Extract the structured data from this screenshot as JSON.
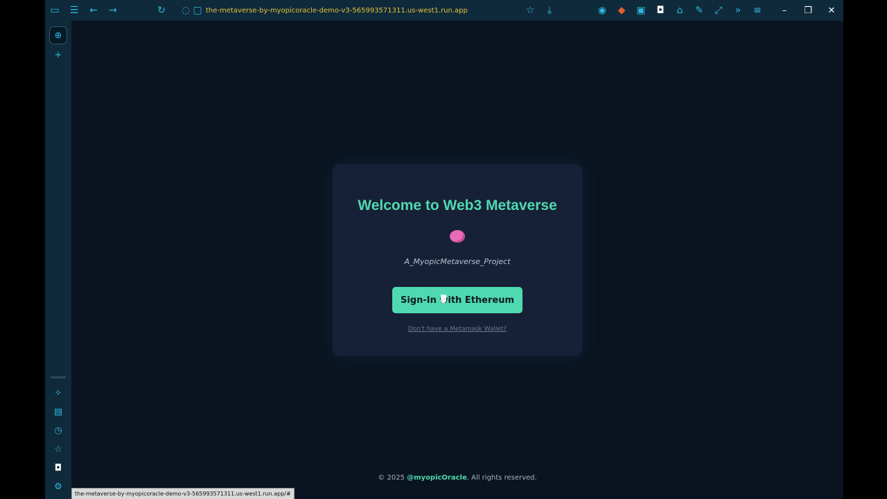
{
  "browser": {
    "url": "the-metaverse-by-myopicoracle-demo-v3-565993571311.us-west1.run.app",
    "status_url": "the-metaverse-by-myopicoracle-demo-v3-565993571311.us-west1.run.app/#",
    "toolbar_icons": [
      "sidebar-toggle-icon",
      "tabs-icon",
      "back-arrow-icon",
      "forward-arrow-icon",
      "reload-icon",
      "shield-icon",
      "lock-icon",
      "star-icon",
      "download-icon",
      "extension-icons"
    ],
    "window_controls": {
      "minimize": "–",
      "restore": "❐",
      "close": "✕"
    },
    "sidebar_icons": [
      "globe-icon",
      "plus-icon",
      "sparkle-icon",
      "reader-icon",
      "history-icon",
      "star-icon",
      "shield-icon",
      "settings-icon"
    ]
  },
  "card": {
    "title": "Welcome to Web3 Metaverse",
    "subtitle": "A_MyopicMetaverse_Project",
    "signin_label": "Sign-In with Ethereum",
    "no_wallet_link": "Don't have a Metamask Wallet?"
  },
  "footer": {
    "prefix": "© 2025 ",
    "handle": "@myopicOracle",
    "suffix": ". All rights reserved."
  },
  "colors": {
    "accent": "#4fd9b0",
    "card_bg": "#162036",
    "page_bg": "#0a1420",
    "url_text": "#e8c23a",
    "toolbar_icon": "#2fb8e0"
  }
}
